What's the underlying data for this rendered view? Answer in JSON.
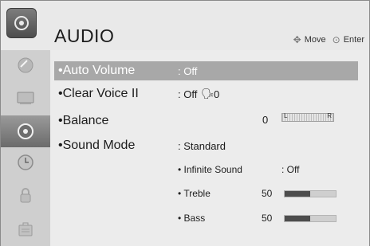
{
  "header": {
    "title": "AUDIO",
    "hint_move": "Move",
    "hint_enter": "Enter",
    "icon": "audio-disc-icon"
  },
  "sidebar": {
    "items": [
      {
        "icon": "satellite-dish-icon"
      },
      {
        "icon": "picture-screen-icon"
      },
      {
        "icon": "audio-disc-icon",
        "active": true
      },
      {
        "icon": "clock-icon"
      },
      {
        "icon": "lock-icon"
      },
      {
        "icon": "options-briefcase-icon"
      }
    ]
  },
  "menu": {
    "auto_volume": {
      "label": "•Auto Volume",
      "value": ": Off"
    },
    "clear_voice": {
      "label": "•Clear Voice II",
      "value": ": Off",
      "level": "0"
    },
    "balance": {
      "label": "•Balance",
      "value": "0",
      "left_mark": "L",
      "right_mark": "R",
      "position": 0
    },
    "sound_mode": {
      "label": "•Sound Mode",
      "value": ": Standard"
    },
    "infinite_sound": {
      "label": "• Infinite Sound",
      "value": ": Off"
    },
    "treble": {
      "label": "• Treble",
      "value": "50",
      "level": 50
    },
    "bass": {
      "label": "• Bass",
      "value": "50",
      "level": 50
    }
  },
  "colors": {
    "highlight": "#a8a8a8",
    "active_sidebar": "#7a7a7a",
    "bar_fill": "#4d4d4d"
  }
}
